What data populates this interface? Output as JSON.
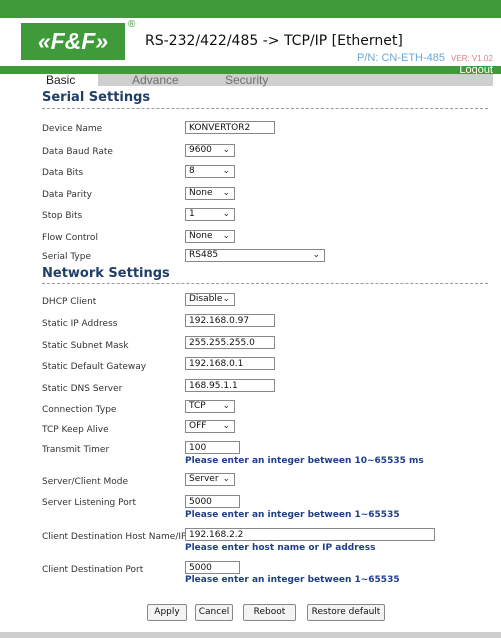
{
  "header": {
    "logo_text": "«F&F»",
    "registered_mark": "®",
    "title": "RS-232/422/485 -> TCP/IP [Ethernet]",
    "part_number": "P/N: CN-ETH-485",
    "version": "VER: V1.02",
    "logout_label": "Logout"
  },
  "tabs": [
    {
      "label": "Basic",
      "active": true
    },
    {
      "label": "Advance",
      "active": false
    },
    {
      "label": "Security",
      "active": false
    }
  ],
  "serial": {
    "heading": "Serial Settings",
    "device_name": {
      "label": "Device Name",
      "value": "KONVERTOR2"
    },
    "baud_rate": {
      "label": "Data Baud Rate",
      "value": "9600"
    },
    "data_bits": {
      "label": "Data Bits",
      "value": "8"
    },
    "parity": {
      "label": "Data Parity",
      "value": "None"
    },
    "stop_bits": {
      "label": "Stop Bits",
      "value": "1"
    },
    "flow_control": {
      "label": "Flow Control",
      "value": "None"
    },
    "serial_type": {
      "label": "Serial Type",
      "value": "RS485"
    }
  },
  "network": {
    "heading": "Network Settings",
    "dhcp": {
      "label": "DHCP Client",
      "value": "Disable"
    },
    "ip": {
      "label": "Static IP Address",
      "value": "192.168.0.97"
    },
    "mask": {
      "label": "Static Subnet Mask",
      "value": "255.255.255.0"
    },
    "gateway": {
      "label": "Static Default Gateway",
      "value": "192.168.0.1"
    },
    "dns": {
      "label": "Static DNS Server",
      "value": "168.95.1.1"
    },
    "conn_type": {
      "label": "Connection Type",
      "value": "TCP"
    },
    "keep_alive": {
      "label": "TCP Keep Alive",
      "value": "OFF"
    },
    "transmit_timer": {
      "label": "Transmit Timer",
      "value": "100",
      "hint": "Please enter an integer between 10~65535 ms"
    },
    "mode": {
      "label": "Server/Client Mode",
      "value": "Server"
    },
    "listen_port": {
      "label": "Server Listening Port",
      "value": "5000",
      "hint": "Please enter an integer between 1~65535"
    },
    "dest_host": {
      "label": "Client Destination Host Name/IP",
      "value": "192.168.2.2",
      "hint": "Please enter host name or IP address"
    },
    "dest_port": {
      "label": "Client Destination Port",
      "value": "5000",
      "hint": "Please enter an integer between 1~65535"
    }
  },
  "buttons": {
    "apply": "Apply",
    "cancel": "Cancel",
    "reboot": "Reboot",
    "restore": "Restore default"
  },
  "colors": {
    "brand_green": "#3f9a3a",
    "heading_blue": "#1f3e68",
    "hint_blue": "#1f3e8a"
  },
  "icons": {
    "dropdown": "chevron-down-icon"
  }
}
